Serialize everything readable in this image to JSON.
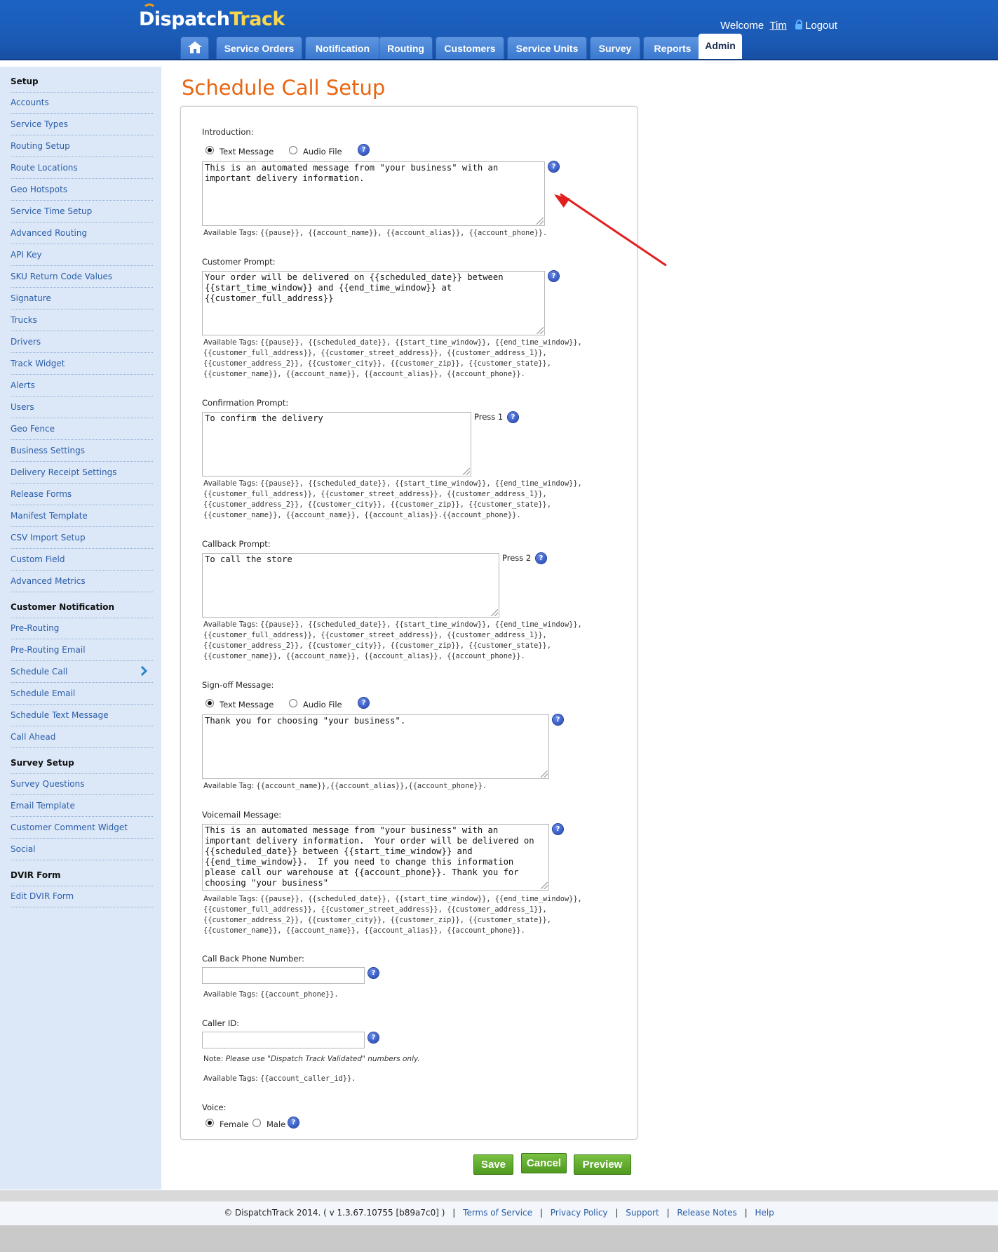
{
  "header": {
    "logo_part1": "Dispatch",
    "logo_part2": "Track",
    "welcome_label": "Welcome",
    "user_name": "Tim",
    "logout_label": "Logout",
    "tabs": [
      "Service Orders",
      "Notification",
      "Routing",
      "Customers",
      "Service Units",
      "Survey",
      "Reports",
      "Admin"
    ],
    "active_tab": "Admin"
  },
  "sidebar": {
    "sections": [
      {
        "title": "Setup",
        "items": [
          "Accounts",
          "Service Types",
          "Routing Setup",
          "Route Locations",
          "Geo Hotspots",
          "Service Time Setup",
          "Advanced Routing",
          "API Key",
          "SKU Return Code Values",
          "Signature",
          "Trucks",
          "Drivers",
          "Track Widget",
          "Alerts",
          "Users",
          "Geo Fence",
          "Business Settings",
          "Delivery Receipt Settings",
          "Release Forms",
          "Manifest Template",
          "CSV Import Setup",
          "Custom Field",
          "Advanced Metrics"
        ]
      },
      {
        "title": "Customer Notification",
        "items": [
          "Pre-Routing",
          "Pre-Routing Email",
          "Schedule Call",
          "Schedule Email",
          "Schedule Text Message",
          "Call Ahead"
        ]
      },
      {
        "title": "Survey Setup",
        "items": [
          "Survey Questions",
          "Email Template",
          "Customer Comment Widget",
          "Social"
        ]
      },
      {
        "title": "DVIR Form",
        "items": [
          "Edit DVIR Form"
        ]
      }
    ],
    "selected_item": "Schedule Call"
  },
  "main": {
    "title": "Schedule Call Setup",
    "introduction": {
      "label": "Introduction:",
      "radio_text": "Text Message",
      "radio_audio": "Audio File",
      "selected": "Text Message",
      "value": "This is an automated message from \"your business\" with an important delivery information.",
      "tags_label": "Available Tags:",
      "tags": "{{pause}}, {{account_name}}, {{account_alias}}, {{account_phone}}."
    },
    "customer_prompt": {
      "label": "Customer Prompt:",
      "value": "Your order will be delivered on {{scheduled_date}} between {{start_time_window}} and {{end_time_window}} at {{customer_full_address}}",
      "tags_label": "Available Tags:",
      "tags": "{{pause}}, {{scheduled_date}}, {{start_time_window}}, {{end_time_window}}, {{customer_full_address}}, {{customer_street_address}}, {{customer_address_1}}, {{customer_address_2}}, {{customer_city}}, {{customer_zip}}, {{customer_state}}, {{customer_name}}, {{account_name}}, {{account_alias}}, {{account_phone}}."
    },
    "confirmation_prompt": {
      "label": "Confirmation Prompt:",
      "value": "To confirm the delivery",
      "press": "Press 1",
      "tags_label": "Available Tags:",
      "tags": "{{pause}}, {{scheduled_date}}, {{start_time_window}}, {{end_time_window}}, {{customer_full_address}}, {{customer_street_address}}, {{customer_address_1}}, {{customer_address_2}}, {{customer_city}}, {{customer_zip}}, {{customer_state}}, {{customer_name}}, {{account_name}}, {{account_alias}}.{{account_phone}}."
    },
    "callback_prompt": {
      "label": "Callback Prompt:",
      "value": "To call the store",
      "press": "Press 2",
      "tags_label": "Available Tags:",
      "tags": "{{pause}}, {{scheduled_date}}, {{start_time_window}}, {{end_time_window}}, {{customer_full_address}}, {{customer_street_address}}, {{customer_address_1}}, {{customer_address_2}}, {{customer_city}}, {{customer_zip}}, {{customer_state}}, {{customer_name}}, {{account_name}}, {{account_alias}}, {{account_phone}}."
    },
    "signoff": {
      "label": "Sign-off Message:",
      "radio_text": "Text Message",
      "radio_audio": "Audio File",
      "selected": "Text Message",
      "value": "Thank you for choosing \"your business\".",
      "tags_label": "Available Tag:",
      "tags": "{{account_name}},{{account_alias}},{{account_phone}}."
    },
    "voicemail": {
      "label": "Voicemail Message:",
      "value": "This is an automated message from \"your business\" with an important delivery information.  Your order will be delivered on {{scheduled_date}} between {{start_time_window}} and {{end_time_window}}.  If you need to change this information please call our warehouse at {{account_phone}}. Thank you for choosing \"your business\"",
      "tags_label": "Available Tags:",
      "tags": "{{pause}}, {{scheduled_date}}, {{start_time_window}}, {{end_time_window}}, {{customer_full_address}}, {{customer_street_address}}, {{customer_address_1}}, {{customer_address_2}}, {{customer_city}}, {{customer_zip}}, {{customer_state}}, {{customer_name}}, {{account_name}}, {{account_alias}}, {{account_phone}}."
    },
    "callback_phone": {
      "label": "Call Back Phone Number:",
      "value": "",
      "tags_label": "Available Tags:",
      "tags": "{{account_phone}}."
    },
    "caller_id": {
      "label": "Caller ID:",
      "value": "",
      "note_label": "Note:",
      "note": "Please use \"Dispatch Track Validated\" numbers only.",
      "tags_label": "Available Tags:",
      "tags": "{{account_caller_id}}."
    },
    "voice": {
      "label": "Voice:",
      "female": "Female",
      "male": "Male",
      "selected": "Female"
    },
    "buttons": {
      "save": "Save",
      "cancel": "Cancel",
      "preview": "Preview"
    },
    "help_glyph": "?"
  },
  "footer": {
    "copyright": "© DispatchTrack 2014.  ( v 1.3.67.10755 [b89a7c0] )",
    "links": [
      "Terms of Service",
      "Privacy Policy",
      "Support",
      "Release Notes",
      "Help"
    ],
    "separator": "|"
  },
  "colors": {
    "header_blue": "#1a5ab4",
    "title_orange": "#e86510",
    "link_blue": "#2a5da8",
    "button_green": "#5ba82a",
    "annotation_red": "#e21f1f",
    "sidebar_bg": "#dce8f8"
  }
}
